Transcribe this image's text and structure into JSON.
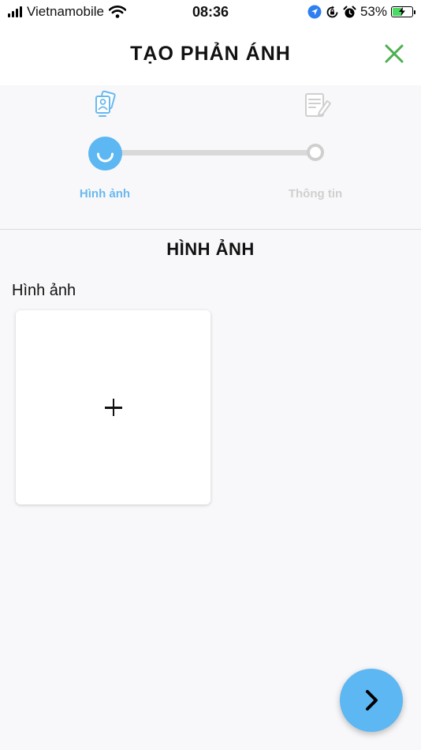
{
  "status_bar": {
    "carrier": "Vietnamobile",
    "time": "08:36",
    "battery_percent": "53%",
    "battery_level": 0.53
  },
  "header": {
    "title": "TẠO PHẢN ÁNH",
    "close_icon": "close-icon"
  },
  "stepper": {
    "steps": [
      {
        "label": "Hình ảnh",
        "icon": "photos-icon",
        "active": true
      },
      {
        "label": "Thông tin",
        "icon": "document-edit-icon",
        "active": false
      }
    ]
  },
  "section": {
    "title": "HÌNH ẢNH",
    "field_label": "Hình ảnh"
  },
  "upload": {
    "icon": "plus-icon"
  },
  "fab": {
    "icon": "chevron-right-icon"
  },
  "colors": {
    "accent": "#5db7f2",
    "active_label": "#6ab9ee",
    "inactive": "#cfcfcf",
    "close_icon": "#4caf50",
    "background": "#f8f8fa"
  }
}
